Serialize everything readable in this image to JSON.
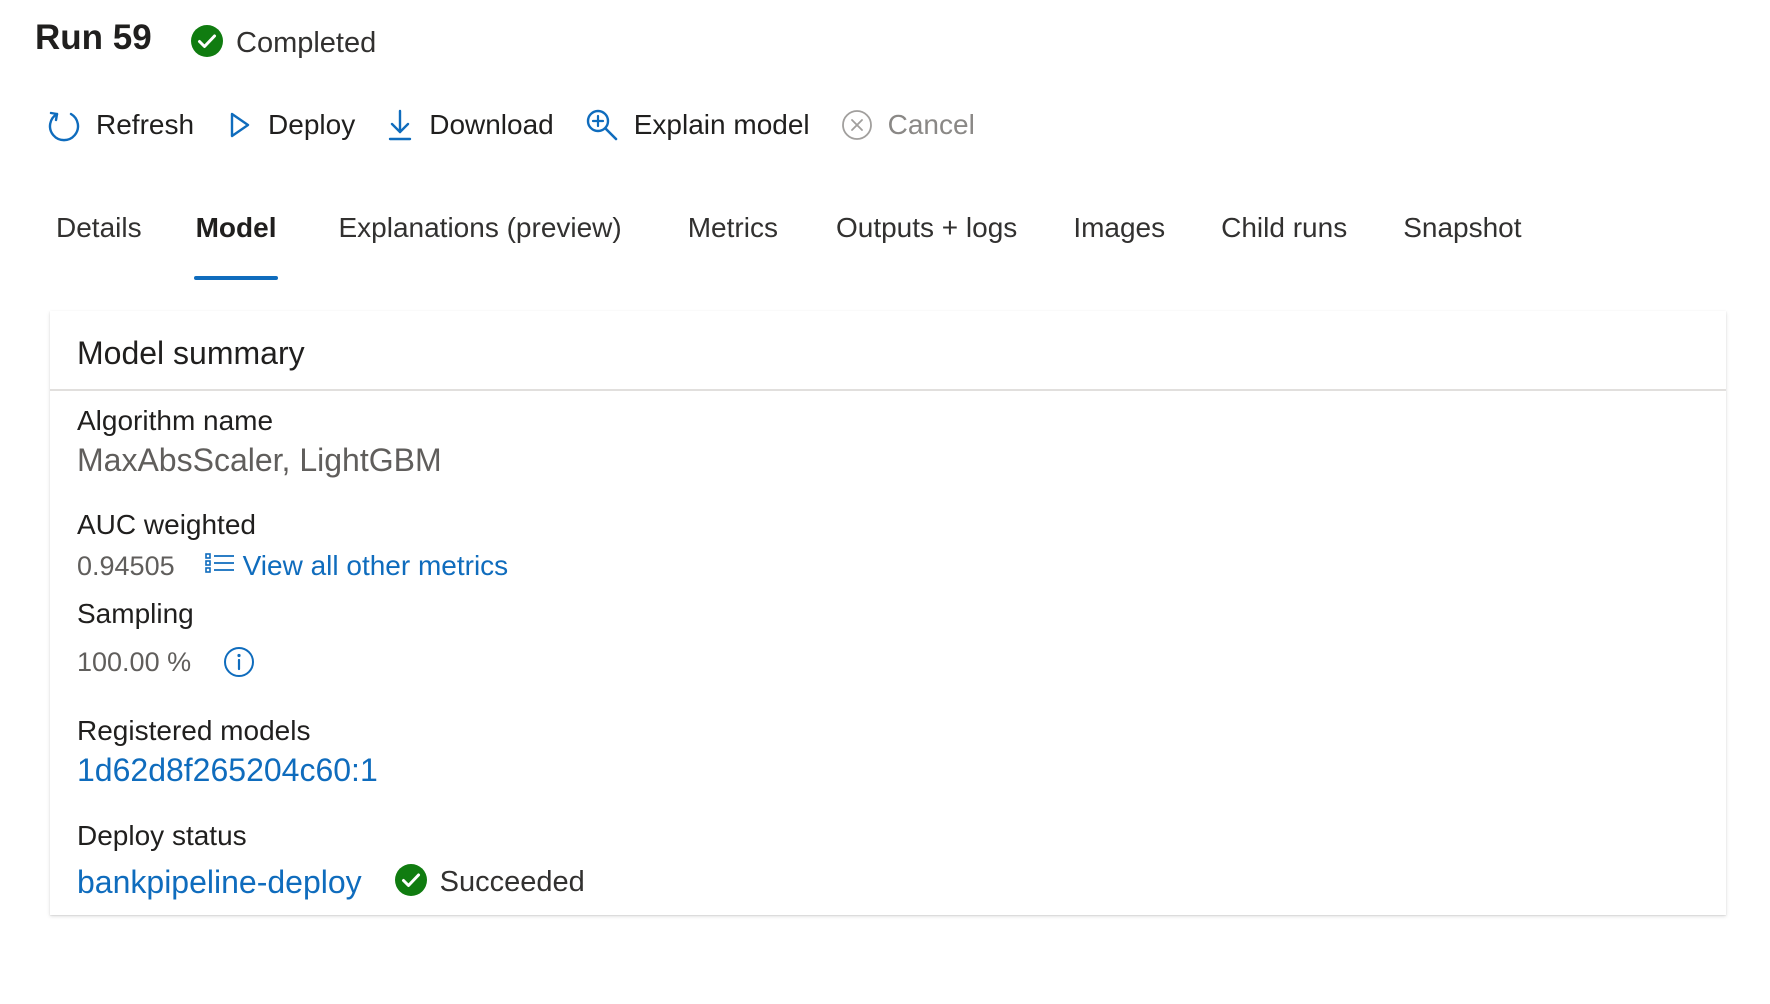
{
  "header": {
    "title": "Run 59",
    "status": {
      "label": "Completed",
      "icon": "check-circle-icon",
      "color": "#107c10"
    }
  },
  "toolbar": {
    "refresh_label": "Refresh",
    "deploy_label": "Deploy",
    "download_label": "Download",
    "explain_label": "Explain model",
    "cancel_label": "Cancel"
  },
  "tabs": [
    {
      "label": "Details",
      "active": false
    },
    {
      "label": "Model",
      "active": true
    },
    {
      "label": "Explanations (preview)",
      "active": false
    },
    {
      "label": "Metrics",
      "active": false
    },
    {
      "label": "Outputs + logs",
      "active": false
    },
    {
      "label": "Images",
      "active": false
    },
    {
      "label": "Child runs",
      "active": false
    },
    {
      "label": "Snapshot",
      "active": false
    }
  ],
  "model_summary": {
    "title": "Model summary",
    "algorithm": {
      "label": "Algorithm name",
      "value": "MaxAbsScaler, LightGBM"
    },
    "auc": {
      "label": "AUC weighted",
      "value": "0.94505",
      "link_label": "View all other metrics"
    },
    "sampling": {
      "label": "Sampling",
      "value": "100.00 %"
    },
    "registered_models": {
      "label": "Registered models",
      "value": "1d62d8f265204c60:1"
    },
    "deploy_status": {
      "label": "Deploy status",
      "link_label": "bankpipeline-deploy",
      "status": "Succeeded"
    }
  },
  "colors": {
    "accent": "#0f6cbd",
    "success": "#107c10",
    "disabled": "#8a8886"
  }
}
